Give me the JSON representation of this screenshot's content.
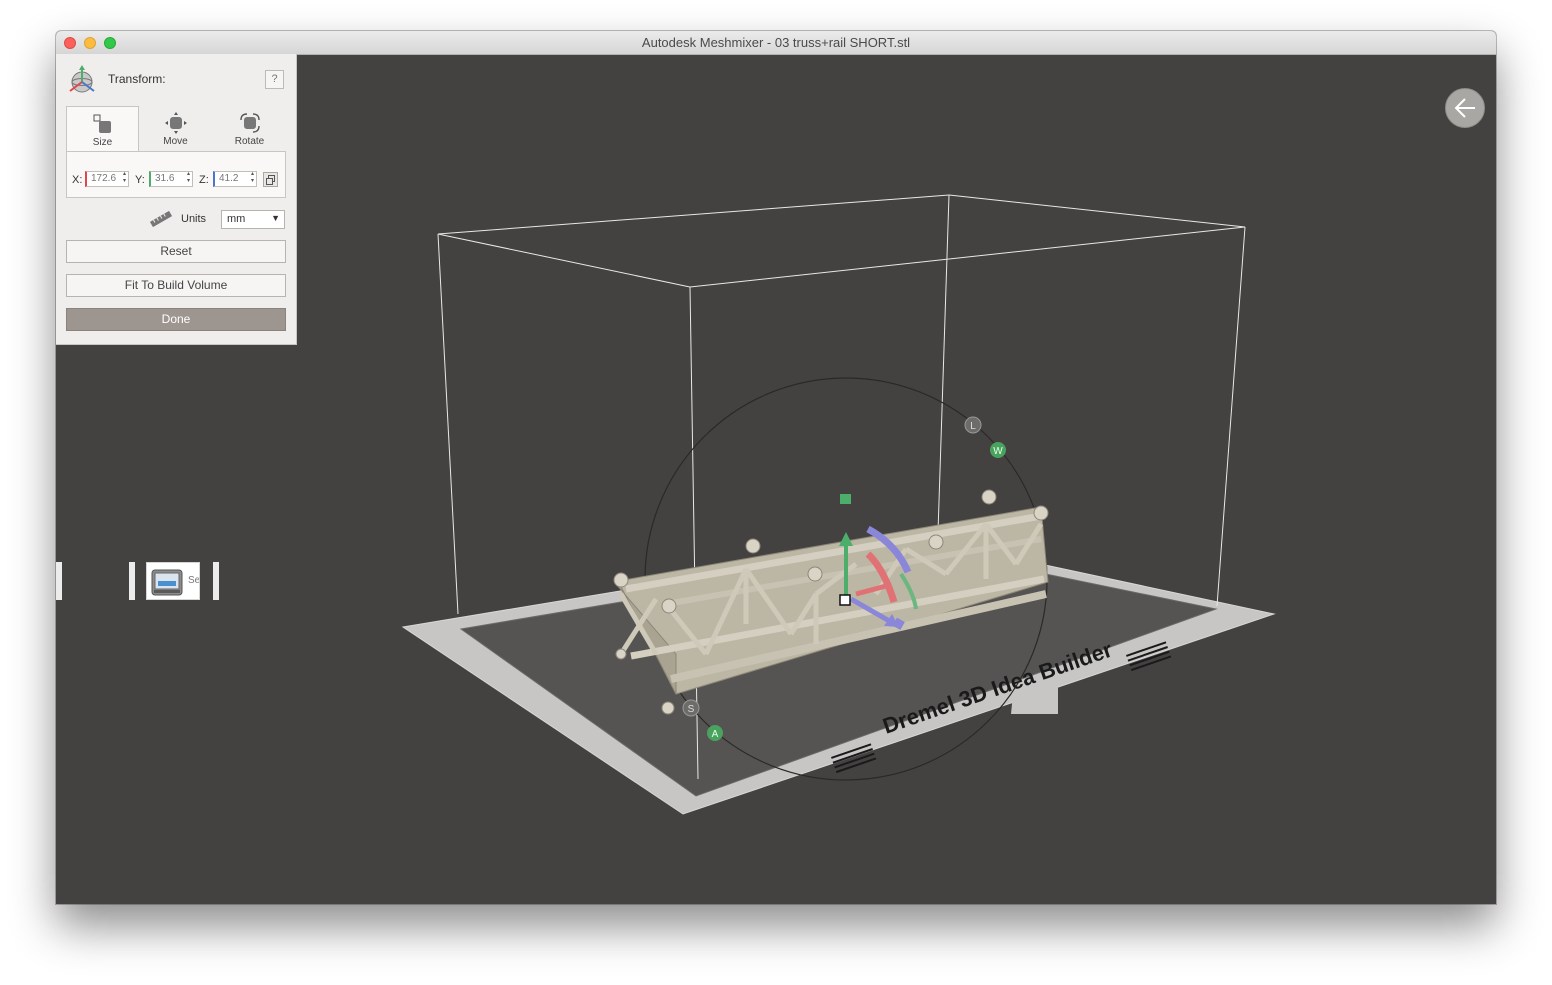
{
  "window": {
    "title": "Autodesk Meshmixer - 03 truss+rail SHORT.stl"
  },
  "transform_panel": {
    "title": "Transform:",
    "help_label": "?",
    "tabs": [
      {
        "label": "Size",
        "active": true
      },
      {
        "label": "Move",
        "active": false
      },
      {
        "label": "Rotate",
        "active": false
      }
    ],
    "fields": {
      "x_label": "X:",
      "x_value": "172.6",
      "y_label": "Y:",
      "y_value": "31.6",
      "z_label": "Z:",
      "z_value": "41.2"
    },
    "units_label": "Units",
    "units_value": "mm",
    "reset_label": "Reset",
    "fit_label": "Fit To Build Volume",
    "done_label": "Done"
  },
  "left_toolbar": {
    "send_label": "Send T"
  },
  "scene": {
    "bed_label": "Dremel 3D Idea Builder",
    "handle_labels": [
      "L",
      "W",
      "S",
      "A"
    ]
  },
  "colors": {
    "viewport_bg": "#444241",
    "panel_bg": "#f0eeec",
    "x_axis": "#e0474c",
    "y_axis": "#4cae6a",
    "z_axis": "#4a77c9",
    "done_button": "#9d9590"
  }
}
